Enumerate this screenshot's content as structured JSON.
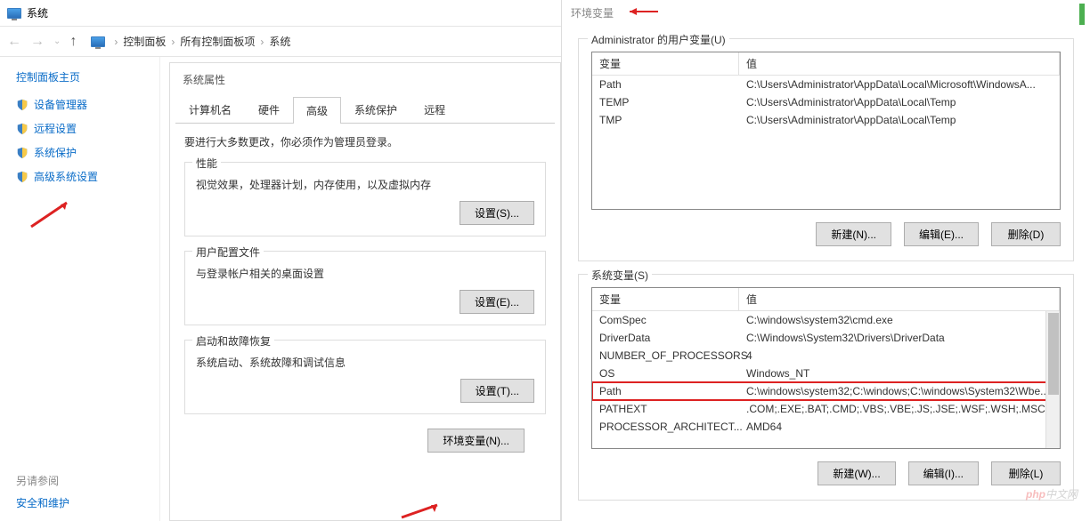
{
  "window": {
    "title": "系统"
  },
  "nav": {
    "back_icon": "←",
    "fwd_icon": "→",
    "up_icon": "↑",
    "crumbs": [
      "控制面板",
      "所有控制面板项",
      "系统"
    ]
  },
  "sidebar": {
    "heading": "控制面板主页",
    "items": [
      {
        "label": "设备管理器"
      },
      {
        "label": "远程设置"
      },
      {
        "label": "系统保护"
      },
      {
        "label": "高级系统设置"
      }
    ],
    "see_also": "另请参阅",
    "sec_maint": "安全和维护"
  },
  "props": {
    "title": "系统属性",
    "tabs": [
      "计算机名",
      "硬件",
      "高级",
      "系统保护",
      "远程"
    ],
    "admin_msg": "要进行大多数更改，你必须作为管理员登录。",
    "perf": {
      "title": "性能",
      "desc": "视觉效果，处理器计划，内存使用，以及虚拟内存",
      "btn": "设置(S)..."
    },
    "prof": {
      "title": "用户配置文件",
      "desc": "与登录帐户相关的桌面设置",
      "btn": "设置(E)..."
    },
    "boot": {
      "title": "启动和故障恢复",
      "desc": "系统启动、系统故障和调试信息",
      "btn": "设置(T)..."
    },
    "env_btn": "环境变量(N)..."
  },
  "env": {
    "title": "环境变量",
    "user_legend": "Administrator 的用户变量(U)",
    "col_var": "变量",
    "col_val": "值",
    "user_vars": [
      {
        "name": "Path",
        "value": "C:\\Users\\Administrator\\AppData\\Local\\Microsoft\\WindowsA..."
      },
      {
        "name": "TEMP",
        "value": "C:\\Users\\Administrator\\AppData\\Local\\Temp"
      },
      {
        "name": "TMP",
        "value": "C:\\Users\\Administrator\\AppData\\Local\\Temp"
      }
    ],
    "sys_legend": "系统变量(S)",
    "sys_vars": [
      {
        "name": "ComSpec",
        "value": "C:\\windows\\system32\\cmd.exe"
      },
      {
        "name": "DriverData",
        "value": "C:\\Windows\\System32\\Drivers\\DriverData"
      },
      {
        "name": "NUMBER_OF_PROCESSORS",
        "value": "4"
      },
      {
        "name": "OS",
        "value": "Windows_NT"
      },
      {
        "name": "Path",
        "value": "C:\\windows\\system32;C:\\windows;C:\\windows\\System32\\Wbe...",
        "selected": true
      },
      {
        "name": "PATHEXT",
        "value": ".COM;.EXE;.BAT;.CMD;.VBS;.VBE;.JS;.JSE;.WSF;.WSH;.MSC"
      },
      {
        "name": "PROCESSOR_ARCHITECT...",
        "value": "AMD64"
      }
    ],
    "btn_new_u": "新建(N)...",
    "btn_edit_u": "编辑(E)...",
    "btn_del_u": "删除(D)",
    "btn_new_s": "新建(W)...",
    "btn_edit_s": "编辑(I)...",
    "btn_del_s": "删除(L)"
  },
  "watermark": {
    "prefix": "php",
    "rest": "中文网"
  }
}
